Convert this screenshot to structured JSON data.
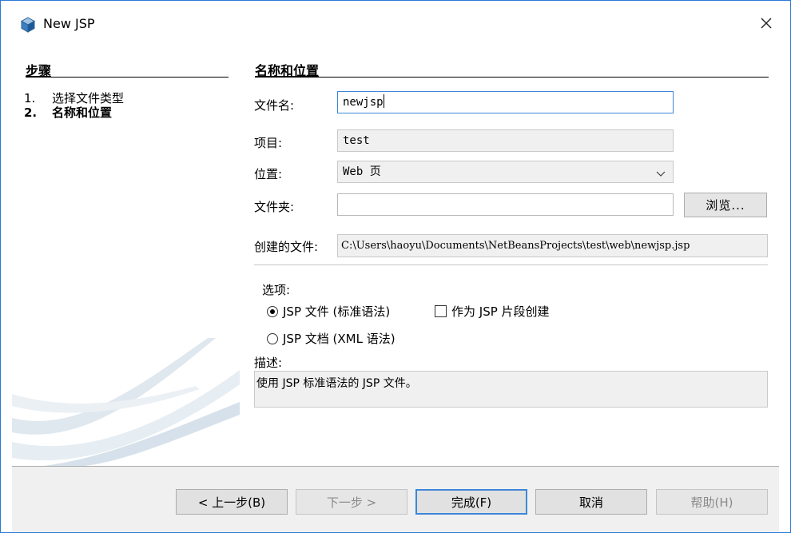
{
  "window": {
    "title": "New JSP",
    "close_glyph": "✕",
    "app_icon": "netbeans-cube-icon",
    "accent": "#2b79d6"
  },
  "steps": {
    "title": "步骤",
    "items": [
      {
        "num": "1.",
        "label": "选择文件类型",
        "current": false
      },
      {
        "num": "2.",
        "label": "名称和位置",
        "current": true
      }
    ]
  },
  "form": {
    "section_title": "名称和位置",
    "file_name_label": "文件名:",
    "file_name_value": "newjsp",
    "project_label": "项目:",
    "project_value": "test",
    "location_label": "位置:",
    "location_value": "Web 页",
    "folder_label": "文件夹:",
    "folder_value": "",
    "browse_label": "浏览...",
    "created_file_label": "创建的文件:",
    "created_file_value": "C:\\Users\\haoyu\\Documents\\NetBeansProjects\\test\\web\\newjsp.jsp"
  },
  "options": {
    "title": "选项:",
    "radio_jsp_file": "JSP 文件 (标准语法)",
    "checkbox_fragment": "作为 JSP 片段创建",
    "radio_jsp_document": "JSP 文档 (XML 语法)",
    "selected": "jsp_file"
  },
  "description": {
    "title": "描述:",
    "text": "使用 JSP 标准语法的 JSP 文件。"
  },
  "buttons": {
    "back": "< 上一步(B)",
    "next": "下一步 >",
    "finish": "完成(F)",
    "cancel": "取消",
    "help": "帮助(H)"
  }
}
